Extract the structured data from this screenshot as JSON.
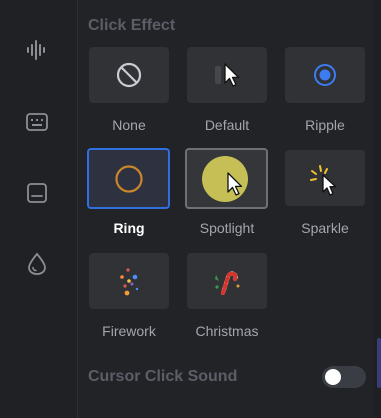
{
  "sidebar": {
    "items": [
      {
        "icon": "audio-wave-icon"
      },
      {
        "icon": "keyboard-icon"
      },
      {
        "icon": "subtitle-icon"
      },
      {
        "icon": "water-drop-icon"
      }
    ]
  },
  "click_effect": {
    "title": "Click Effect",
    "selected": "Ring",
    "options": [
      {
        "label": "None",
        "icon": "none-icon"
      },
      {
        "label": "Default",
        "icon": "default-cursor-icon"
      },
      {
        "label": "Ripple",
        "icon": "ripple-icon"
      },
      {
        "label": "Ring",
        "icon": "ring-icon"
      },
      {
        "label": "Spotlight",
        "icon": "spotlight-icon"
      },
      {
        "label": "Sparkle",
        "icon": "sparkle-icon"
      },
      {
        "label": "Firework",
        "icon": "firework-icon"
      },
      {
        "label": "Christmas",
        "icon": "christmas-icon"
      }
    ]
  },
  "cursor_click_sound": {
    "label": "Cursor Click Sound",
    "enabled": false
  },
  "colors": {
    "accent": "#2f6fe0",
    "ring": "#c9862a",
    "spotlight": "#c5bf55"
  }
}
